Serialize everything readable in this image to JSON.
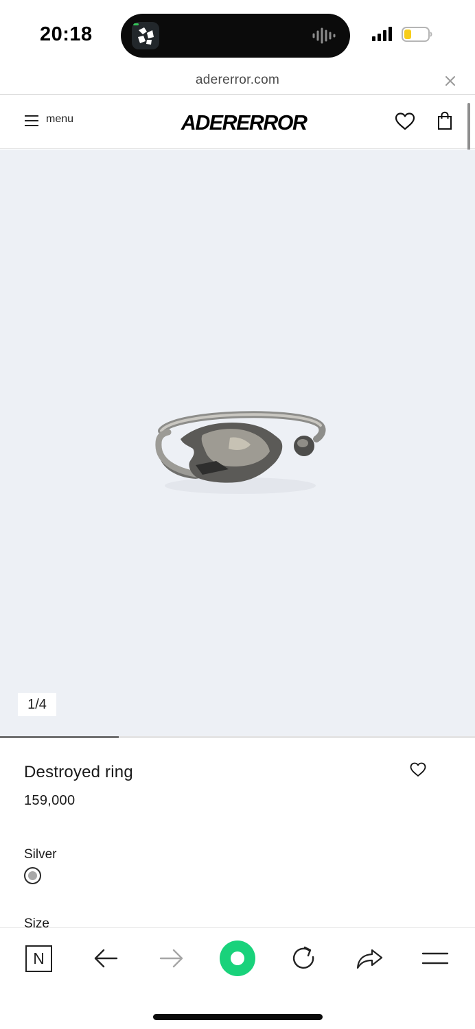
{
  "status_bar": {
    "time": "20:18"
  },
  "browser": {
    "url": "adererror.com"
  },
  "header": {
    "menu_label": "menu",
    "logo": "ADERERROR"
  },
  "gallery": {
    "counter": "1/4",
    "progress_fraction": 0.25
  },
  "product": {
    "name": "Destroyed ring",
    "price": "159,000",
    "color_label": "Silver",
    "size_label": "Size"
  },
  "colors": {
    "accent_green": "#19d27b",
    "image_background": "#edf0f5",
    "battery_yellow": "#f7cd1a"
  },
  "icons": [
    "menu-icon",
    "heart-icon",
    "bag-icon",
    "close-icon",
    "back-arrow-icon",
    "forward-arrow-icon",
    "reload-icon",
    "share-icon",
    "hamburger-icon"
  ]
}
